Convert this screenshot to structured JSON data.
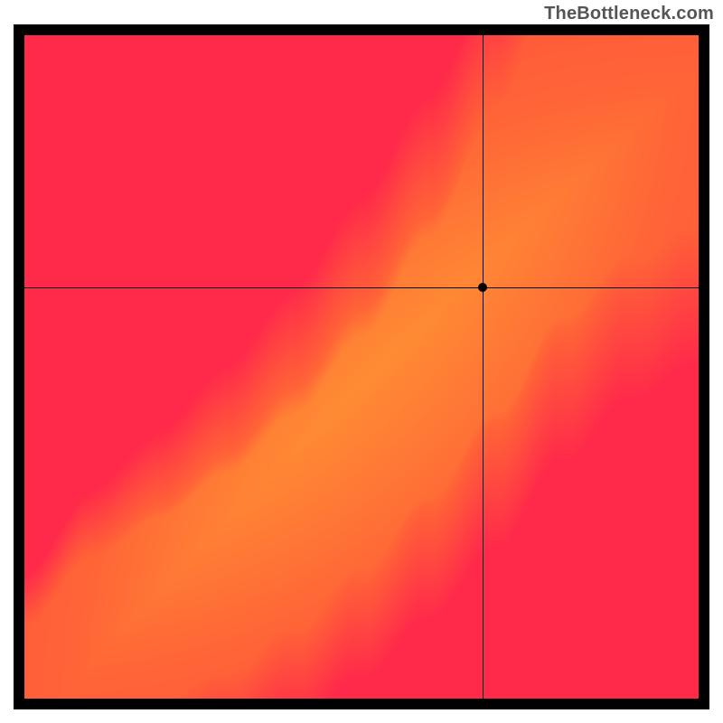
{
  "watermark": "TheBottleneck.com",
  "chart_data": {
    "type": "heatmap",
    "title": "",
    "xlabel": "",
    "ylabel": "",
    "xlim": [
      0,
      100
    ],
    "ylim": [
      0,
      100
    ],
    "crosshair": {
      "x": 68,
      "y": 62
    },
    "marker": {
      "x": 68,
      "y": 62
    },
    "color_scale": {
      "low": "#ff2a4a",
      "mid_warm": "#ff8a2a",
      "mid": "#ffe84a",
      "optimal": "#00d68a",
      "note": "green along ridge where components are balanced; red far from ridge"
    },
    "ridge_points": [
      {
        "x": 0,
        "y": 0
      },
      {
        "x": 10,
        "y": 9
      },
      {
        "x": 20,
        "y": 14
      },
      {
        "x": 30,
        "y": 20
      },
      {
        "x": 40,
        "y": 28
      },
      {
        "x": 50,
        "y": 38
      },
      {
        "x": 60,
        "y": 50
      },
      {
        "x": 70,
        "y": 64
      },
      {
        "x": 80,
        "y": 80
      },
      {
        "x": 90,
        "y": 92
      },
      {
        "x": 100,
        "y": 100
      }
    ],
    "ridge_width": 8
  }
}
